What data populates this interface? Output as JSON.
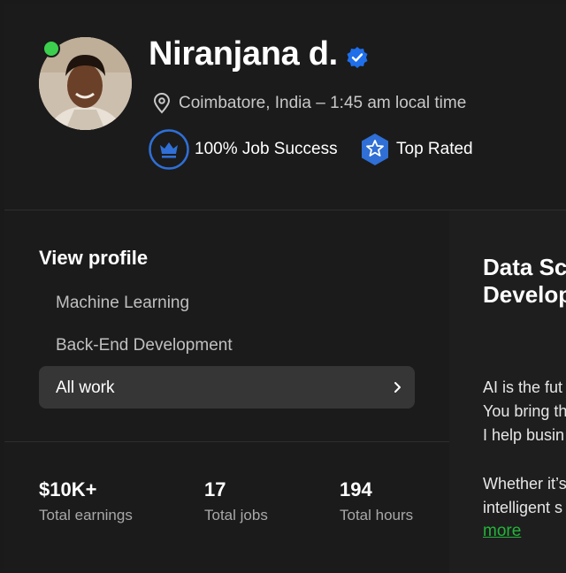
{
  "profile": {
    "name": "Niranjana d.",
    "location": "Coimbatore, India – 1:45 am local time",
    "badges": {
      "job_success": "100% Job Success",
      "top_rated": "Top Rated"
    }
  },
  "sidebar": {
    "title": "View profile",
    "items": [
      {
        "label": "Machine Learning"
      },
      {
        "label": "Back-End Development"
      },
      {
        "label": "All work",
        "selected": true
      }
    ]
  },
  "stats": [
    {
      "value": "$10K+",
      "label": "Total earnings"
    },
    {
      "value": "17",
      "label": "Total jobs"
    },
    {
      "value": "194",
      "label": "Total hours"
    }
  ],
  "overview": {
    "title_lines": [
      "Data Sc",
      "Develop"
    ],
    "paragraph1": [
      "AI is the fut",
      "You bring th",
      "I help busin"
    ],
    "paragraph2": [
      "Whether it’s",
      "intelligent s"
    ],
    "more_link": "more"
  },
  "colors": {
    "background": "#1b1b1b",
    "online": "#3ccf4e",
    "badge_blue": "#2f6fd6",
    "link_green": "#24b33a"
  },
  "icons": [
    "verified-badge-icon",
    "location-pin-icon",
    "crown-icon",
    "star-badge-icon",
    "chevron-right-icon"
  ]
}
